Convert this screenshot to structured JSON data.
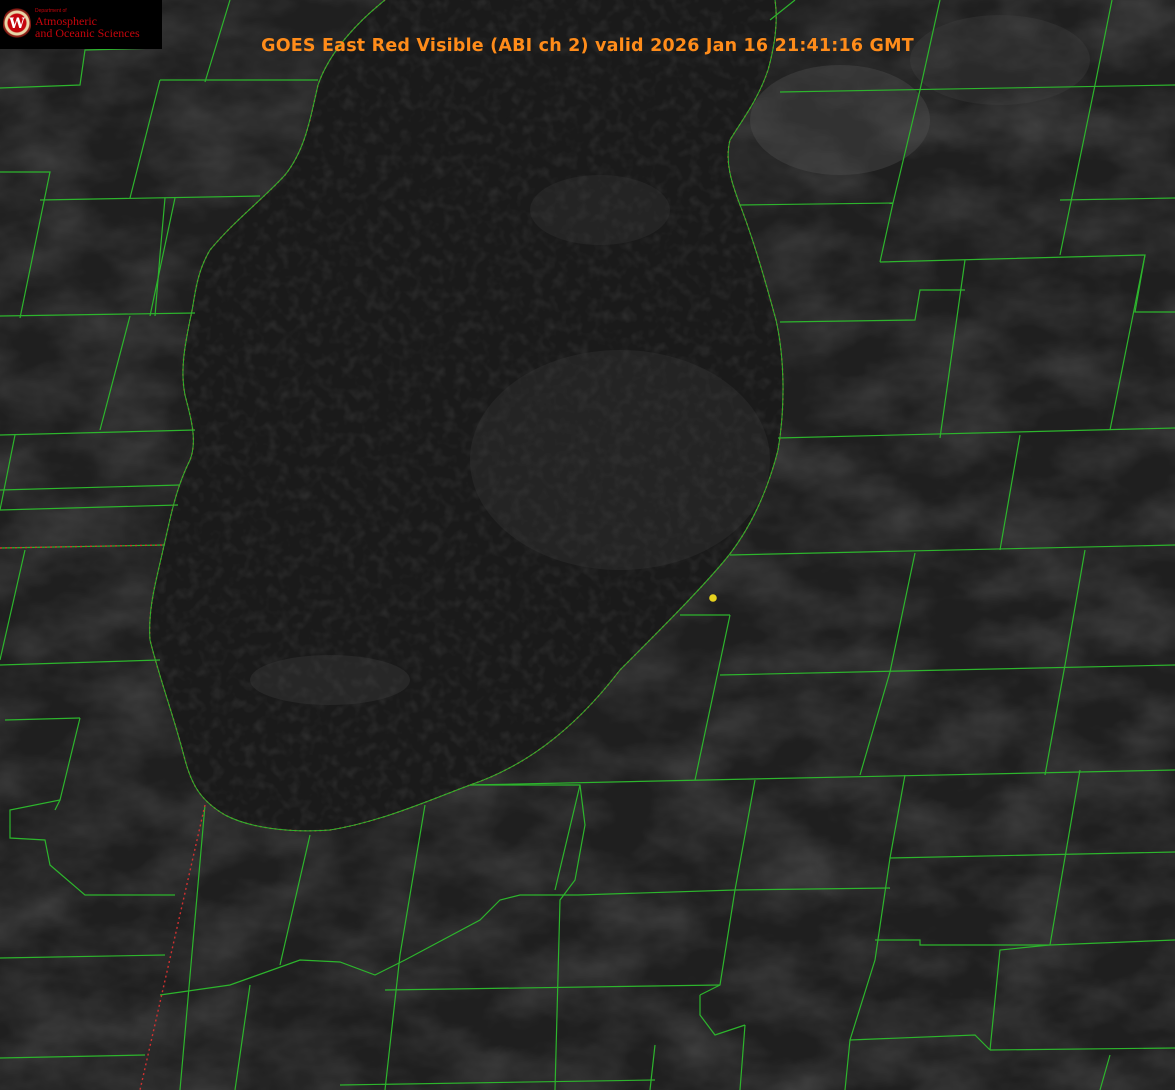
{
  "header": {
    "title": "GOES East Red Visible (ABI ch 2) valid 2026 Jan 16 21:41:16 GMT"
  },
  "logo": {
    "department": "Department of",
    "line1": "Atmospheric",
    "line2": "and Oceanic Sciences"
  },
  "map": {
    "colors": {
      "background": "#1c1c1c",
      "lake": "#181818",
      "county_lines": "#2db52d",
      "state_border": "#d03030",
      "marker": "#e6d21e",
      "title": "#ff8c1a"
    },
    "layers": [
      "satellite-visible",
      "county-boundaries",
      "state-boundaries",
      "lake-shoreline",
      "station-marker"
    ]
  }
}
